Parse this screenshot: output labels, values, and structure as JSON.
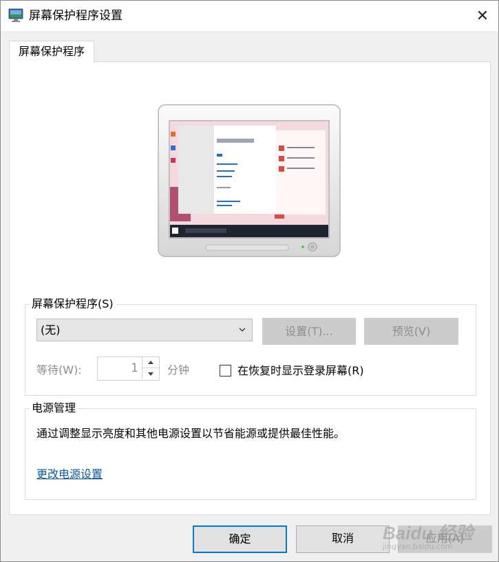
{
  "window": {
    "title": "屏幕保护程序设置",
    "close_glyph": "✕"
  },
  "tab": {
    "label": "屏幕保护程序"
  },
  "screensaver": {
    "group_label": "屏幕保护程序(S)",
    "group_access_key": "S",
    "selected": "(无)",
    "settings_button": "设置(T)...",
    "preview_button": "预览(V)",
    "wait_label": "等待(W):",
    "wait_value": "1",
    "wait_unit": "分钟",
    "resume_checkbox_label": "在恢复时显示登录屏幕(R)",
    "resume_checked": false
  },
  "power": {
    "group_label": "电源管理",
    "description": "通过调整显示亮度和其他电源设置以节省能源或提供最佳性能。",
    "link": "更改电源设置"
  },
  "buttons": {
    "ok": "确定",
    "cancel": "取消",
    "apply": "应用(A)"
  },
  "watermark": {
    "brand": "Baidu 经验",
    "url": "jingyan.baidu.com"
  },
  "colors": {
    "link": "#0a5aa8",
    "default_button_border": "#0078d7",
    "disabled_text": "#8d8d8d"
  },
  "icons": {
    "title": "monitor-icon",
    "close": "close-icon",
    "dropdown": "chevron-down-icon",
    "spin_up": "spin-up-icon",
    "spin_down": "spin-down-icon"
  }
}
